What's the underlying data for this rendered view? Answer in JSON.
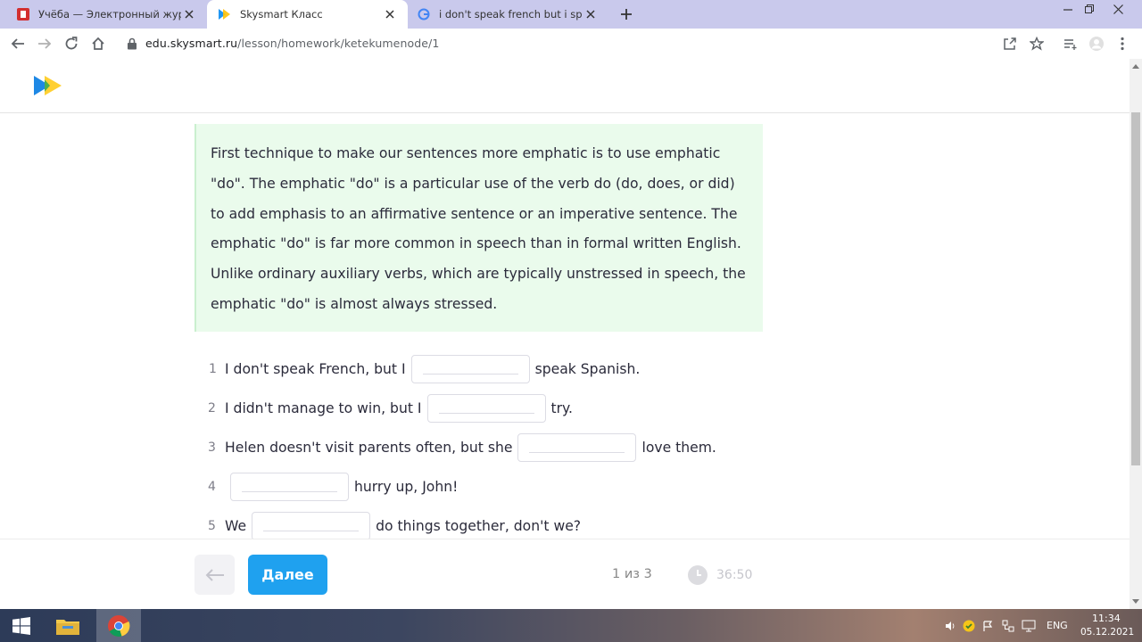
{
  "browser": {
    "tabs": [
      {
        "title": "Учёба — Электронный журнал",
        "active": false
      },
      {
        "title": "Skysmart Класс",
        "active": true
      },
      {
        "title": "i don't speak french but i speak s",
        "active": false
      }
    ],
    "url_host": "edu.skysmart.ru",
    "url_path": "/lesson/homework/ketekumenode/1"
  },
  "lesson": {
    "info_text": "First technique to make our sentences more emphatic is to use emphatic \"do\". The emphatic \"do\" is a particular use of the verb do (do, does, or did) to add emphasis to an affirmative sentence or an imperative sentence. The emphatic \"do\" is far more common in speech than in formal written English. Unlike ordinary auxiliary verbs, which are typically unstressed in speech, the emphatic \"do\" is almost always stressed.",
    "items": [
      {
        "num": "1",
        "before": "I don't speak French, but I",
        "after": "speak Spanish."
      },
      {
        "num": "2",
        "before": "I didn't manage to win, but I",
        "after": "try."
      },
      {
        "num": "3",
        "before": "Helen doesn't visit parents often, but she",
        "after": "love them."
      },
      {
        "num": "4",
        "before": "",
        "after": "hurry up, John!"
      },
      {
        "num": "5",
        "before": "We",
        "after": "do things together, don't we?"
      }
    ]
  },
  "footer": {
    "next_label": "Далее",
    "progress_text": "1 из 3",
    "timer_text": "36:50"
  },
  "taskbar": {
    "lang": "ENG",
    "time": "11:34",
    "date": "05.12.2021"
  },
  "colors": {
    "accent": "#1fa1ef",
    "info_bg": "#eafbec",
    "tabstrip": "#c9c9ec"
  }
}
